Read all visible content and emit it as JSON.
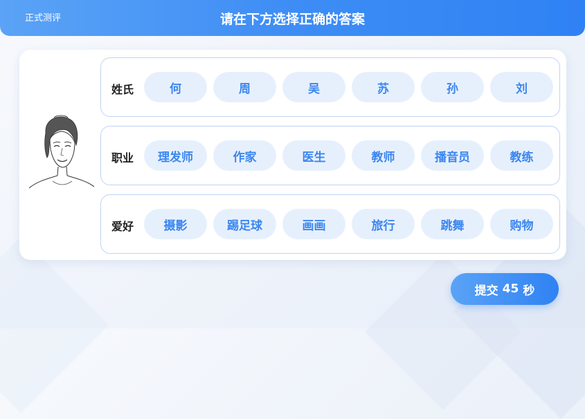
{
  "header": {
    "left_label": "正式测评",
    "title": "请在下方选择正确的答案"
  },
  "rows": [
    {
      "label": "姓氏",
      "options": [
        "何",
        "周",
        "吴",
        "苏",
        "孙",
        "刘"
      ]
    },
    {
      "label": "职业",
      "options": [
        "理发师",
        "作家",
        "医生",
        "教师",
        "播音员",
        "教练"
      ]
    },
    {
      "label": "爱好",
      "options": [
        "摄影",
        "踢足球",
        "画画",
        "旅行",
        "跳舞",
        "购物"
      ]
    }
  ],
  "submit": {
    "label": "提交",
    "seconds": "45",
    "unit": "秒"
  },
  "colors": {
    "accent": "#3e8df5",
    "option_bg": "#e6f0fd",
    "option_text": "#3b86ef",
    "row_border": "#bfd4f3"
  },
  "icons": {
    "portrait": "woman-portrait-sketch"
  }
}
